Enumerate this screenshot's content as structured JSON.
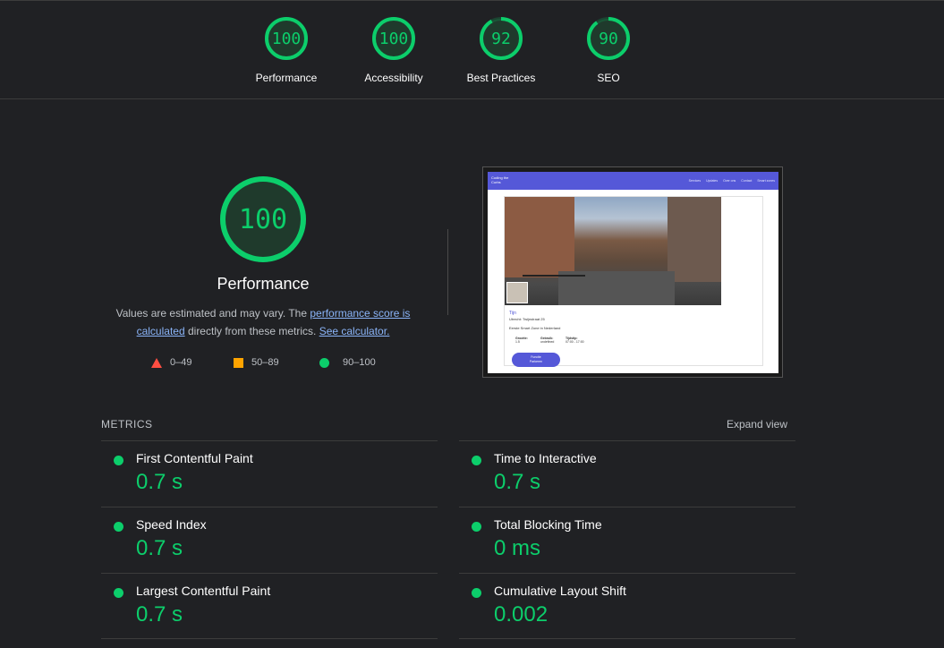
{
  "colors": {
    "pass": "#0cce6b",
    "average": "#ffa400",
    "fail": "#ff4e42",
    "link": "#8ab4f8"
  },
  "gauges": [
    {
      "score": "100",
      "label": "Performance",
      "fraction": 1.0
    },
    {
      "score": "100",
      "label": "Accessibility",
      "fraction": 1.0
    },
    {
      "score": "92",
      "label": "Best Practices",
      "fraction": 0.92
    },
    {
      "score": "90",
      "label": "SEO",
      "fraction": 0.9
    }
  ],
  "main": {
    "score": "100",
    "fraction": 1.0,
    "title": "Performance",
    "desc_part1": "Values are estimated and may vary. The ",
    "desc_link1": "performance score is calculated",
    "desc_part2": " directly from these metrics. ",
    "desc_link2": "See calculator.",
    "legend": [
      {
        "icon": "red-triangle-icon",
        "range": "0–49"
      },
      {
        "icon": "orange-square-icon",
        "range": "50–89"
      },
      {
        "icon": "green-circle-icon",
        "range": "90–100"
      }
    ]
  },
  "screenshot": {
    "brand": "Coding the Curbs",
    "nav": [
      "Services",
      "Updates",
      "Over ons",
      "Contact",
      "Smart zones"
    ],
    "title": "Tijn",
    "address": "Utrecht: Twijnstraat 25",
    "zone": "Eerste Smart Zone in Nederland",
    "table": [
      {
        "head": "Grootte:",
        "value": "1.5"
      },
      {
        "head": "Gebruik:",
        "value": "undefined"
      },
      {
        "head": "Tijdstip:",
        "value": "07:00 - 17:00"
      }
    ],
    "button": [
      "Functie",
      "Parkeren"
    ]
  },
  "metrics": {
    "heading": "METRICS",
    "expand": "Expand view",
    "items": [
      {
        "title": "First Contentful Paint",
        "value": "0.7 s"
      },
      {
        "title": "Time to Interactive",
        "value": "0.7 s"
      },
      {
        "title": "Speed Index",
        "value": "0.7 s"
      },
      {
        "title": "Total Blocking Time",
        "value": "0 ms"
      },
      {
        "title": "Largest Contentful Paint",
        "value": "0.7 s"
      },
      {
        "title": "Cumulative Layout Shift",
        "value": "0.002"
      }
    ]
  }
}
